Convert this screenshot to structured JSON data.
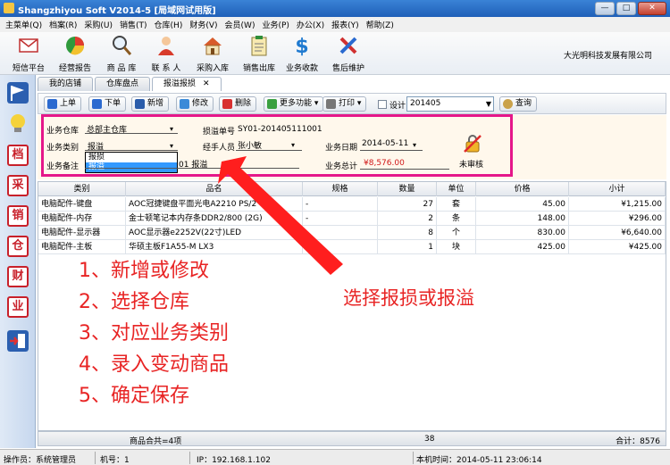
{
  "window": {
    "title": "Shangzhiyou Soft V2014-5 [局域网试用版]",
    "min": "—",
    "max": "□",
    "close": "✕"
  },
  "menu": [
    "主菜单(Q)",
    "档案(R)",
    "采购(U)",
    "销售(T)",
    "仓库(H)",
    "财务(V)",
    "会员(W)",
    "业务(P)",
    "办公(X)",
    "报表(Y)",
    "帮助(Z)"
  ],
  "icon_toolbar": [
    {
      "label": "短信平台",
      "icon": "envelope-icon"
    },
    {
      "label": "经营报告",
      "icon": "pie-chart-icon"
    },
    {
      "label": "商 品 库",
      "icon": "magnifier-icon"
    },
    {
      "label": "联 系 人",
      "icon": "person-icon"
    },
    {
      "label": "采购入库",
      "icon": "house-icon"
    },
    {
      "label": "销售出库",
      "icon": "clipboard-icon"
    },
    {
      "label": "业务收款",
      "icon": "dollar-icon"
    },
    {
      "label": "售后维护",
      "icon": "tools-icon"
    }
  ],
  "company": "大光明科技发展有限公司",
  "sidebar": [
    {
      "icon": "flag-icon"
    },
    {
      "icon": "lightbulb-icon"
    },
    {
      "icon": "stamp-dang-icon",
      "text": "档"
    },
    {
      "icon": "stamp-cai-icon",
      "text": "采"
    },
    {
      "icon": "stamp-xiao-icon",
      "text": "销"
    },
    {
      "icon": "stamp-cang-icon",
      "text": "仓"
    },
    {
      "icon": "stamp-cai2-icon",
      "text": "财"
    },
    {
      "icon": "stamp-ye-icon",
      "text": "业"
    },
    {
      "icon": "exit-icon"
    }
  ],
  "tabs": [
    {
      "label": "我的店铺",
      "active": false
    },
    {
      "label": "仓库盘点",
      "active": false
    },
    {
      "label": "报溢报损",
      "active": true,
      "close": "✕"
    }
  ],
  "toolbar": {
    "prev": "上单",
    "next": "下单",
    "new": "新增",
    "edit": "修改",
    "delete": "删除",
    "more": "更多功能",
    "print": "打印",
    "design": "设计",
    "period": "201405",
    "query": "查询"
  },
  "form": {
    "warehouse_label": "业务仓库",
    "warehouse_value": "总部主仓库",
    "type_label": "业务类别",
    "type_value": "报溢",
    "type_options": [
      "报损",
      "报溢"
    ],
    "type_selected": "报溢",
    "remark_label": "业务备注",
    "remark_value": "2014-05-01 报溢",
    "remark_visible": "01 报溢",
    "order_no_label": "损溢单号",
    "order_no_value": "SY01-201405111001",
    "handler_label": "经手人员",
    "handler_value": "张小敏",
    "date_label": "业务日期",
    "date_value": "2014-05-11",
    "total_label": "业务总计",
    "total_value": "¥8,576.00",
    "audit_label": "未审核"
  },
  "table": {
    "headers": [
      "类别",
      "品名",
      "规格",
      "数量",
      "单位",
      "价格",
      "小计"
    ],
    "rows": [
      [
        "电脑配件-键盘",
        "AOC冠捷键盘平面光电A2210 PS/2",
        "-",
        "27",
        "套",
        "45.00",
        "¥1,215.00"
      ],
      [
        "电脑配件-内存",
        "金士顿笔记本内存条DDR2/800 (2G)",
        "-",
        "2",
        "条",
        "148.00",
        "¥296.00"
      ],
      [
        "电脑配件-显示器",
        "AOC显示器e2252V(22寸)LED",
        "-",
        "8",
        "个",
        "830.00",
        "¥6,640.00"
      ],
      [
        "电脑配件-主板",
        "华硕主板F1A55-M LX3",
        "",
        "1",
        "块",
        "425.00",
        "¥425.00"
      ]
    ],
    "footer": {
      "summary": "商品合共=4项",
      "qty_total": "38",
      "amount_total": "合计：8576"
    }
  },
  "status": {
    "operator": "操作员：系统管理员",
    "machine": "机号：1",
    "ip": "IP：192.168.1.102",
    "time": "本机时间：2014-05-11 23:06:14"
  },
  "annotations": {
    "steps": [
      "1、新增或修改",
      "2、选择仓库",
      "3、对应业务类别",
      "4、录入变动商品",
      "5、确定保存"
    ],
    "callout": "选择报损或报溢",
    "color": "#e82424",
    "box_color": "#e5178a"
  }
}
